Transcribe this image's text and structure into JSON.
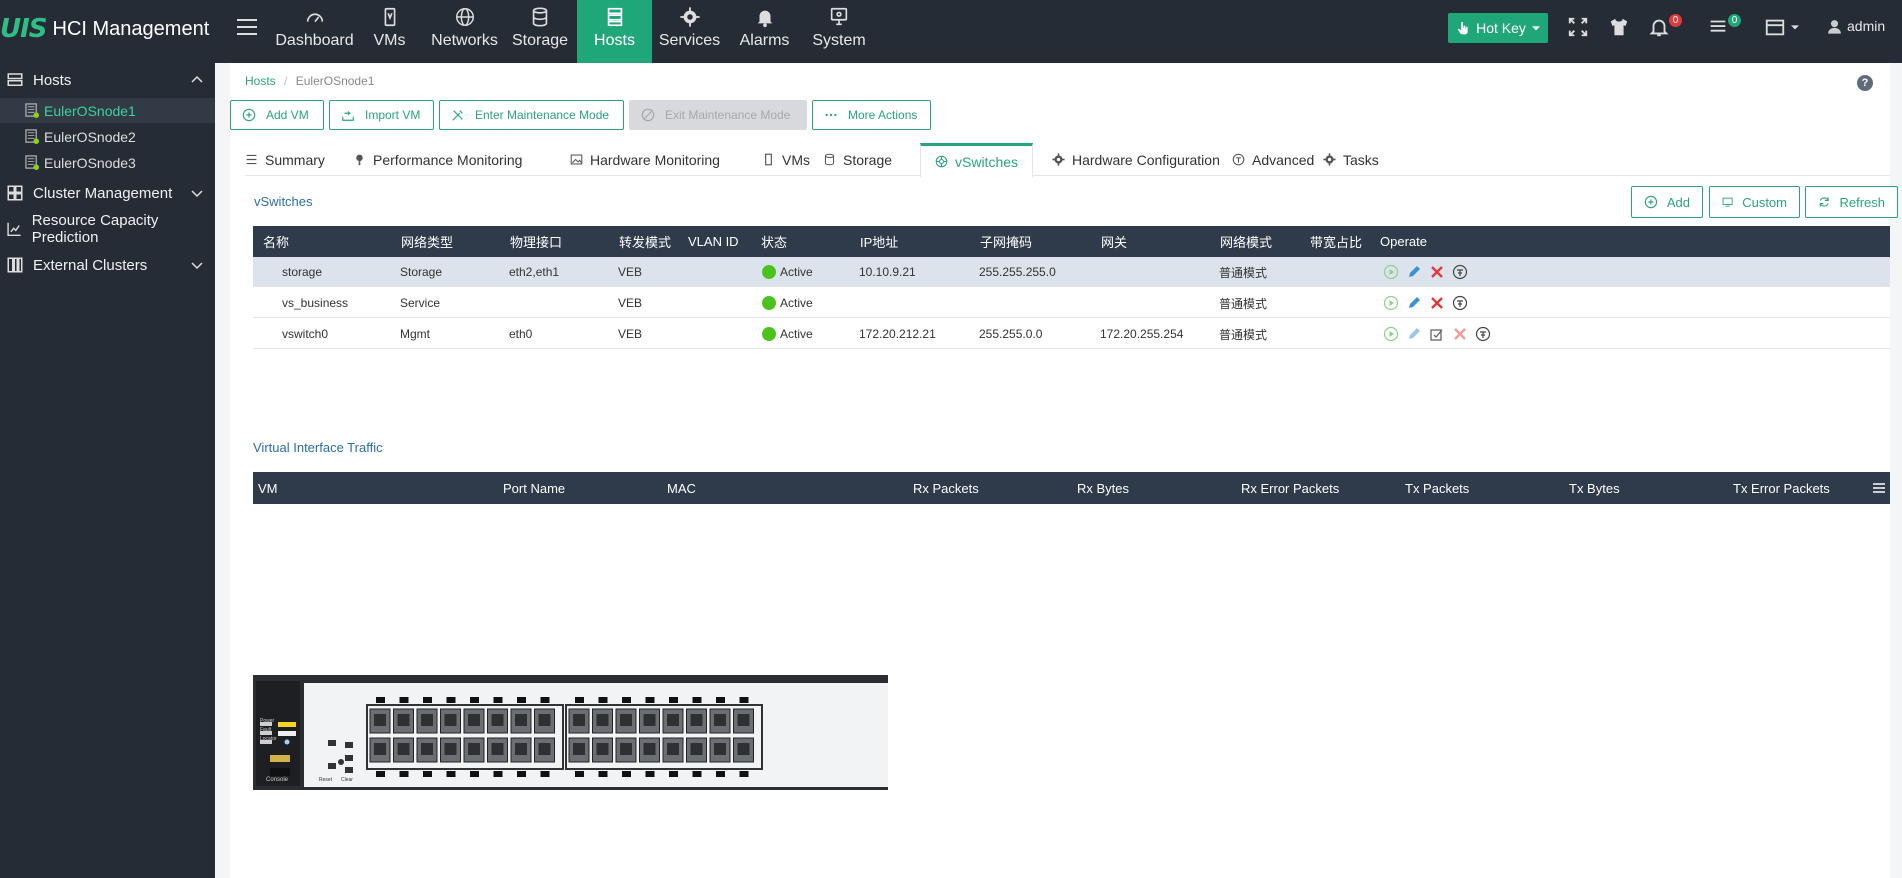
{
  "app": {
    "logo_mark": "UIS",
    "title": "HCI Management"
  },
  "nav": {
    "tabs": [
      {
        "label": "Dashboard",
        "icon": "gauge-icon"
      },
      {
        "label": "VMs",
        "icon": "vm-icon"
      },
      {
        "label": "Networks",
        "icon": "globe-icon"
      },
      {
        "label": "Storage",
        "icon": "database-icon"
      },
      {
        "label": "Hosts",
        "icon": "server-icon",
        "active": true
      },
      {
        "label": "Services",
        "icon": "gear-icon"
      },
      {
        "label": "Alarms",
        "icon": "bell-icon"
      },
      {
        "label": "System",
        "icon": "monitor-icon"
      }
    ],
    "hotkey_label": "Hot Key",
    "alarm_count": "0",
    "task_count": "0",
    "user": "admin"
  },
  "sidebar": {
    "hosts_label": "Hosts",
    "hosts": [
      "EulerOSnode1",
      "EulerOSnode2",
      "EulerOSnode3"
    ],
    "cluster_label": "Cluster Management",
    "capacity_label": "Resource Capacity Prediction",
    "external_label": "External Clusters"
  },
  "breadcrumb": {
    "root": "Hosts",
    "sep": "/",
    "current": "EulerOSnode1"
  },
  "actions": {
    "add_vm": "Add VM",
    "import_vm": "Import VM",
    "enter_maintenance": "Enter Maintenance Mode",
    "exit_maintenance": "Exit Maintenance Mode",
    "more_actions": "More Actions"
  },
  "tabs": {
    "summary": "Summary",
    "performance": "Performance Monitoring",
    "hardware": "Hardware Monitoring",
    "vms": "VMs",
    "storage": "Storage",
    "vswitches": "vSwitches",
    "hwconfig": "Hardware Configuration",
    "advanced": "Advanced",
    "tasks": "Tasks"
  },
  "vswitches": {
    "title": "vSwitches",
    "buttons": {
      "add": "Add",
      "custom": "Custom",
      "refresh": "Refresh"
    },
    "columns": [
      "名称",
      "网络类型",
      "物理接口",
      "转发模式",
      "VLAN ID",
      "状态",
      "IP地址",
      "子网掩码",
      "网关",
      "网络模式",
      "带宽占比",
      "Operate"
    ],
    "rows": [
      {
        "name": "storage",
        "type": "Storage",
        "nic": "eth2,eth1",
        "mode": "VEB",
        "vlan": "",
        "status": "Active",
        "ip": "10.10.9.21",
        "mask": "255.255.255.0",
        "gw": "",
        "netmode": "普通模式",
        "bw": "",
        "selected": true
      },
      {
        "name": "vs_business",
        "type": "Service",
        "nic": "",
        "mode": "VEB",
        "vlan": "",
        "status": "Active",
        "ip": "",
        "mask": "",
        "gw": "",
        "netmode": "普通模式",
        "bw": ""
      },
      {
        "name": "vswitch0",
        "type": "Mgmt",
        "nic": "eth0",
        "mode": "VEB",
        "vlan": "",
        "status": "Active",
        "ip": "172.20.212.21",
        "mask": "255.255.0.0",
        "gw": "172.20.255.254",
        "netmode": "普通模式",
        "bw": ""
      }
    ]
  },
  "traffic": {
    "title": "Virtual Interface Traffic",
    "columns": [
      "VM",
      "Port Name",
      "MAC",
      "Rx Packets",
      "Rx Bytes",
      "Rx Error Packets",
      "Tx Packets",
      "Tx Bytes",
      "Tx Error Packets"
    ]
  },
  "device": {
    "panel_labels": [
      "Power",
      "Fault",
      "Locator"
    ],
    "console_label": "Console",
    "reset_label": "Reset",
    "clear_label": "Clear"
  },
  "colors": {
    "accent": "#20a779",
    "topbar": "#262c36",
    "table_header": "#2f3b4b",
    "status_active": "#4cc31d"
  }
}
